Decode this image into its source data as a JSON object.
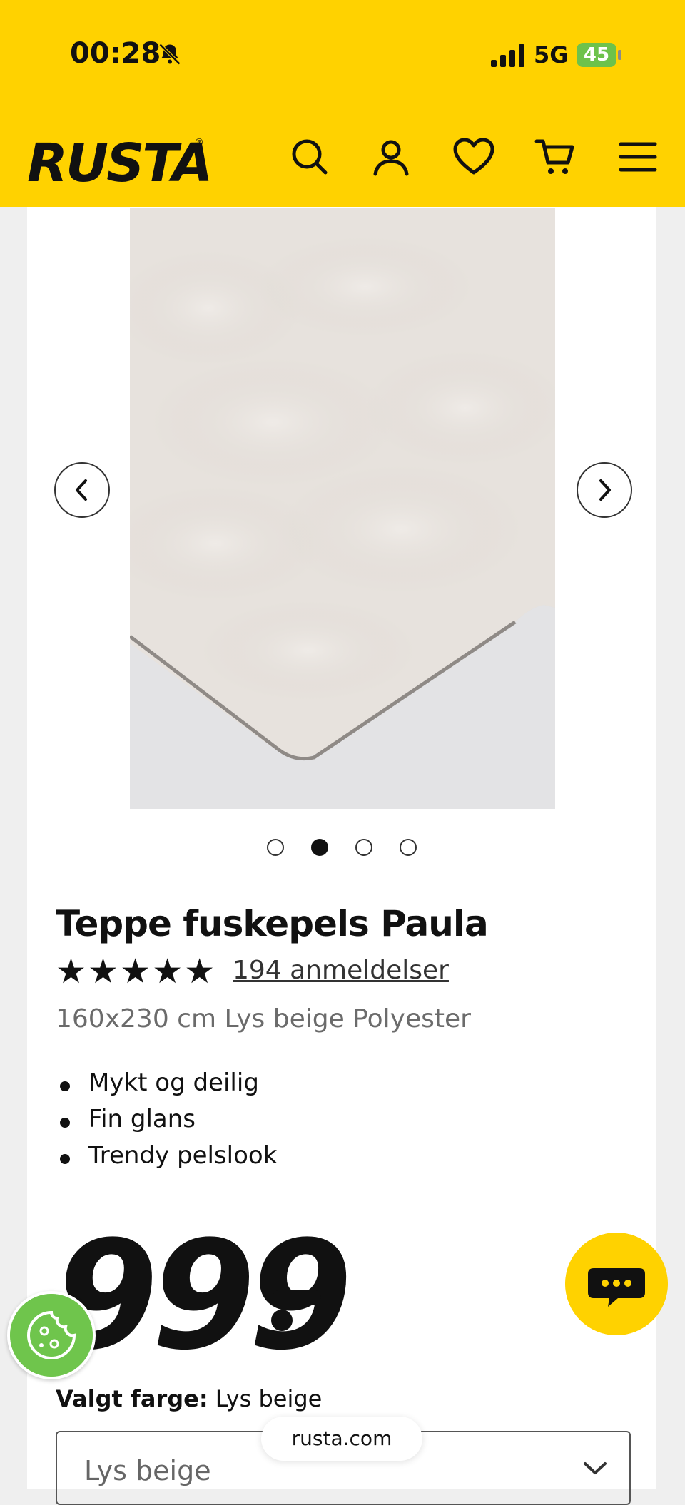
{
  "status_bar": {
    "time": "00:28",
    "network": "5G",
    "battery": "45"
  },
  "header": {
    "logo": "RUSTA",
    "icons": [
      "search-icon",
      "account-icon",
      "heart-icon",
      "cart-icon",
      "menu-icon"
    ],
    "background_color": "#ffd200"
  },
  "gallery": {
    "slide_count": 4,
    "active_index": 1
  },
  "product": {
    "title": "Teppe fuskepels Paula",
    "rating": 5,
    "stars": "★★★★★",
    "reviews_label": "194 anmeldelser",
    "subtitle": "160x230 cm Lys beige Polyester",
    "features": [
      "Mykt og deilig",
      "Fin glans",
      "Trendy pelslook"
    ],
    "price": "999"
  },
  "color": {
    "label": "Valgt farge:",
    "value": "Lys beige",
    "selected": "Lys beige"
  },
  "browser": {
    "url": "rusta.com"
  }
}
